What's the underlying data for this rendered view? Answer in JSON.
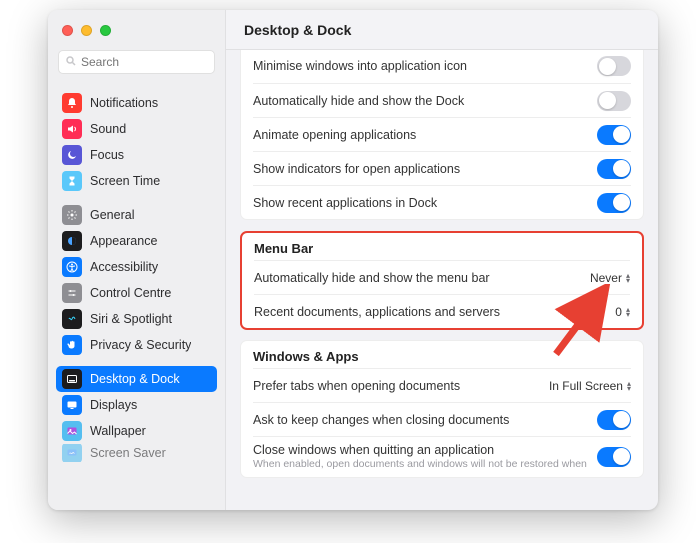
{
  "header": {
    "title": "Desktop & Dock"
  },
  "search": {
    "placeholder": "Search"
  },
  "sidebar": {
    "groups": [
      {
        "items": [
          {
            "key": "notifications",
            "label": "Notifications",
            "bg": "#ff3b30",
            "icon": "bell"
          },
          {
            "key": "sound",
            "label": "Sound",
            "bg": "#ff2d55",
            "icon": "speaker"
          },
          {
            "key": "focus",
            "label": "Focus",
            "bg": "#5856d6",
            "icon": "moon"
          },
          {
            "key": "screen-time",
            "label": "Screen Time",
            "bg": "#5ac8fa",
            "icon": "hourglass"
          }
        ]
      },
      {
        "items": [
          {
            "key": "general",
            "label": "General",
            "bg": "#8e8e93",
            "icon": "gear"
          },
          {
            "key": "appearance",
            "label": "Appearance",
            "bg": "#1c1c1e",
            "icon": "appearance"
          },
          {
            "key": "accessibility",
            "label": "Accessibility",
            "bg": "#0a7aff",
            "icon": "accessibility"
          },
          {
            "key": "control-centre",
            "label": "Control Centre",
            "bg": "#8e8e93",
            "icon": "sliders"
          },
          {
            "key": "siri",
            "label": "Siri & Spotlight",
            "bg": "#1c1c1e",
            "icon": "siri"
          },
          {
            "key": "privacy",
            "label": "Privacy & Security",
            "bg": "#0a7aff",
            "icon": "hand"
          }
        ]
      },
      {
        "items": [
          {
            "key": "desktop-dock",
            "label": "Desktop & Dock",
            "bg": "#1c1c1e",
            "icon": "dock",
            "selected": true
          },
          {
            "key": "displays",
            "label": "Displays",
            "bg": "#0a7aff",
            "icon": "display"
          },
          {
            "key": "wallpaper",
            "label": "Wallpaper",
            "bg": "#55bef0",
            "icon": "wallpaper"
          },
          {
            "key": "screen-saver",
            "label": "Screen Saver",
            "bg": "#55bef0",
            "icon": "screensaver",
            "cutoff": true
          }
        ]
      }
    ]
  },
  "panels": {
    "top": [
      {
        "label": "Minimise windows into application icon",
        "type": "toggle",
        "value": false
      },
      {
        "label": "Automatically hide and show the Dock",
        "type": "toggle",
        "value": false
      },
      {
        "label": "Animate opening applications",
        "type": "toggle",
        "value": true
      },
      {
        "label": "Show indicators for open applications",
        "type": "toggle",
        "value": true
      },
      {
        "label": "Show recent applications in Dock",
        "type": "toggle",
        "value": true
      }
    ],
    "menubar": {
      "title": "Menu Bar",
      "rows": [
        {
          "label": "Automatically hide and show the menu bar",
          "type": "select",
          "value": "Never"
        },
        {
          "label": "Recent documents, applications and servers",
          "type": "select",
          "value": "0"
        }
      ]
    },
    "windows": {
      "title": "Windows & Apps",
      "rows": [
        {
          "label": "Prefer tabs when opening documents",
          "type": "select",
          "value": "In Full Screen"
        },
        {
          "label": "Ask to keep changes when closing documents",
          "type": "toggle",
          "value": true
        },
        {
          "label": "Close windows when quitting an application",
          "sub": "When enabled, open documents and windows will not be restored when",
          "type": "toggle",
          "value": true
        }
      ]
    }
  }
}
